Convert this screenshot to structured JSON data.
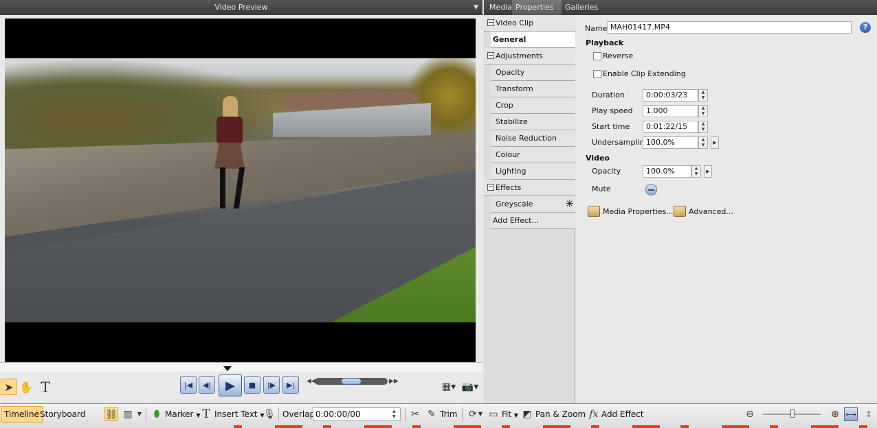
{
  "preview": {
    "title": "Video Preview"
  },
  "tabs": {
    "media": "Media",
    "properties": "Properties",
    "galleries": "Galleries"
  },
  "nav": {
    "video_clip": "Video Clip",
    "general": "General",
    "adjustments": "Adjustments",
    "opacity": "Opacity",
    "transform": "Transform",
    "crop": "Crop",
    "stabilize": "Stabilize",
    "noise_reduction": "Noise Reduction",
    "colour": "Colour",
    "lighting": "Lighting",
    "effects": "Effects",
    "greyscale": "Greyscale",
    "add_effect": "Add Effect..."
  },
  "form": {
    "name_label": "Name",
    "name_value": "MAH01417.MP4",
    "playback_header": "Playback",
    "reverse_label": "Reverse",
    "reverse_checked": false,
    "extend_label": "Enable Clip Extending",
    "extend_checked": false,
    "duration_label": "Duration",
    "duration_value": "0:00:03/23",
    "play_speed_label": "Play speed",
    "play_speed_value": "1.000",
    "start_time_label": "Start time",
    "start_time_value": "0:01:22/15",
    "undersampling_label": "Undersampling",
    "undersampling_value": "100.0%",
    "video_header": "Video",
    "opacity_label": "Opacity",
    "opacity_value": "100.0%",
    "mute_label": "Mute",
    "media_properties": "Media Properties...",
    "advanced": "Advanced..."
  },
  "toolbar": {
    "timeline": "Timeline",
    "storyboard": "Storyboard",
    "marker": "Marker",
    "insert_text": "Insert Text",
    "overlap_label": "Overlap",
    "overlap_value": "0:00:00/00",
    "trim": "Trim",
    "fit": "Fit",
    "pan_zoom": "Pan & Zoom",
    "add_effect": "Add Effect"
  },
  "colors": {
    "accent": "#ffd98a",
    "header_bg": "#3a3a3a",
    "transport": "#a9bdd8"
  }
}
